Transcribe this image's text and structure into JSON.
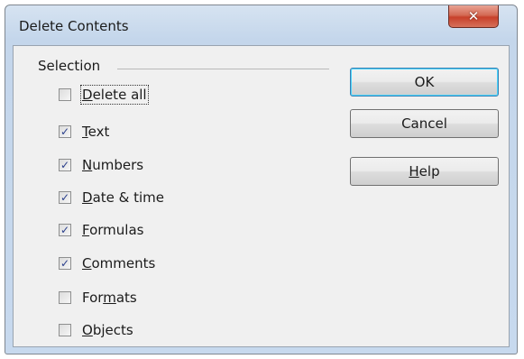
{
  "dialog": {
    "title": "Delete Contents",
    "close_symbol": "✕"
  },
  "selection": {
    "label": "Selection",
    "options": [
      {
        "pre": "",
        "key": "D",
        "post": "elete all",
        "checked": false,
        "focused": true
      },
      {
        "pre": "",
        "key": "T",
        "post": "ext",
        "checked": true,
        "focused": false
      },
      {
        "pre": "",
        "key": "N",
        "post": "umbers",
        "checked": true,
        "focused": false
      },
      {
        "pre": "",
        "key": "D",
        "post": "ate & time",
        "checked": true,
        "focused": false
      },
      {
        "pre": "",
        "key": "F",
        "post": "ormulas",
        "checked": true,
        "focused": false
      },
      {
        "pre": "",
        "key": "C",
        "post": "omments",
        "checked": true,
        "focused": false
      },
      {
        "pre": "For",
        "key": "m",
        "post": "ats",
        "checked": false,
        "focused": false
      },
      {
        "pre": "",
        "key": "O",
        "post": "bjects",
        "checked": false,
        "focused": false
      }
    ]
  },
  "buttons": {
    "ok_label": "OK",
    "cancel_label": "Cancel",
    "help_pre": "",
    "help_key": "H",
    "help_post": "elp"
  },
  "check_symbol": "✓",
  "colors": {
    "title_bar": "#c4d6eb",
    "close_button": "#c8402a",
    "dialog_body": "#f0f0f0",
    "checkmark": "#2a3f8c",
    "default_button_border": "#3c7fb1"
  }
}
